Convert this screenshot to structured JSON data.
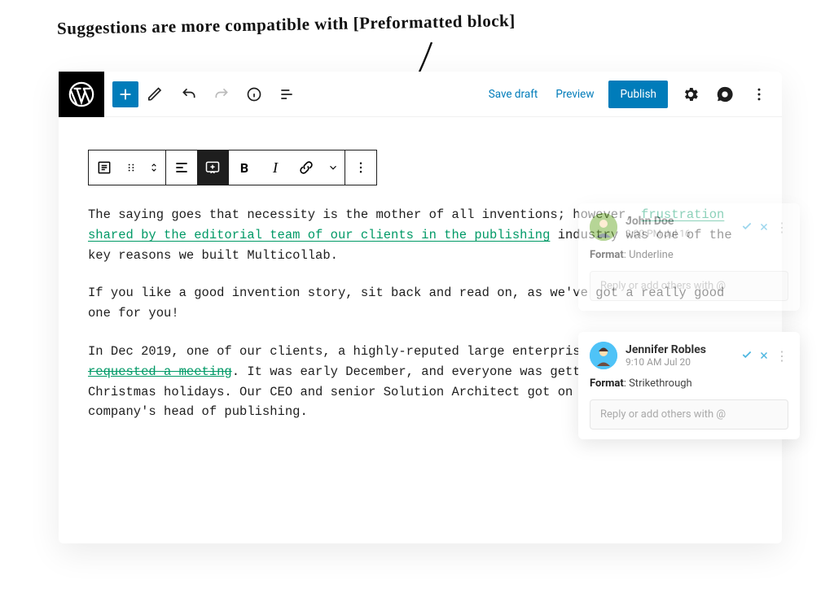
{
  "annotation": "Suggestions are more compatible with [Preformatted block]",
  "toolbar": {
    "save_draft": "Save draft",
    "preview": "Preview",
    "publish": "Publish"
  },
  "block_toolbar": {
    "bold": "B",
    "italic": "I"
  },
  "content": {
    "p1_a": "The saying goes that necessity is the mother of all inventions; however, ",
    "p1_hl": "frustration shared by the editorial team of our clients in the publishing",
    "p1_b": " industry was one of the key reasons we built Multicollab.",
    "p2": "If you like a good invention story, sit back and read on, as we've got a really good one for you!",
    "p3_a": "In Dec 2019, one of our clients, a highly-reputed large enterprise ",
    "p3_hl": "organization, requested a meeting",
    "p3_b": ". It was early December, and everyone was getting ready for the Christmas holidays. Our CEO and senior Solution Architect got on a call with their company's head of publishing."
  },
  "comments": [
    {
      "name": "John Doe",
      "time": "3:00 PM Jul 16",
      "format_label": "Format",
      "format_value": ": Underline",
      "reply_placeholder": "Reply or add others with @"
    },
    {
      "name": "Jennifer Robles",
      "time": "9:10 AM Jul 20",
      "format_label": "Format",
      "format_value": ": Strikethrough",
      "reply_placeholder": "Reply or add others with @"
    }
  ]
}
